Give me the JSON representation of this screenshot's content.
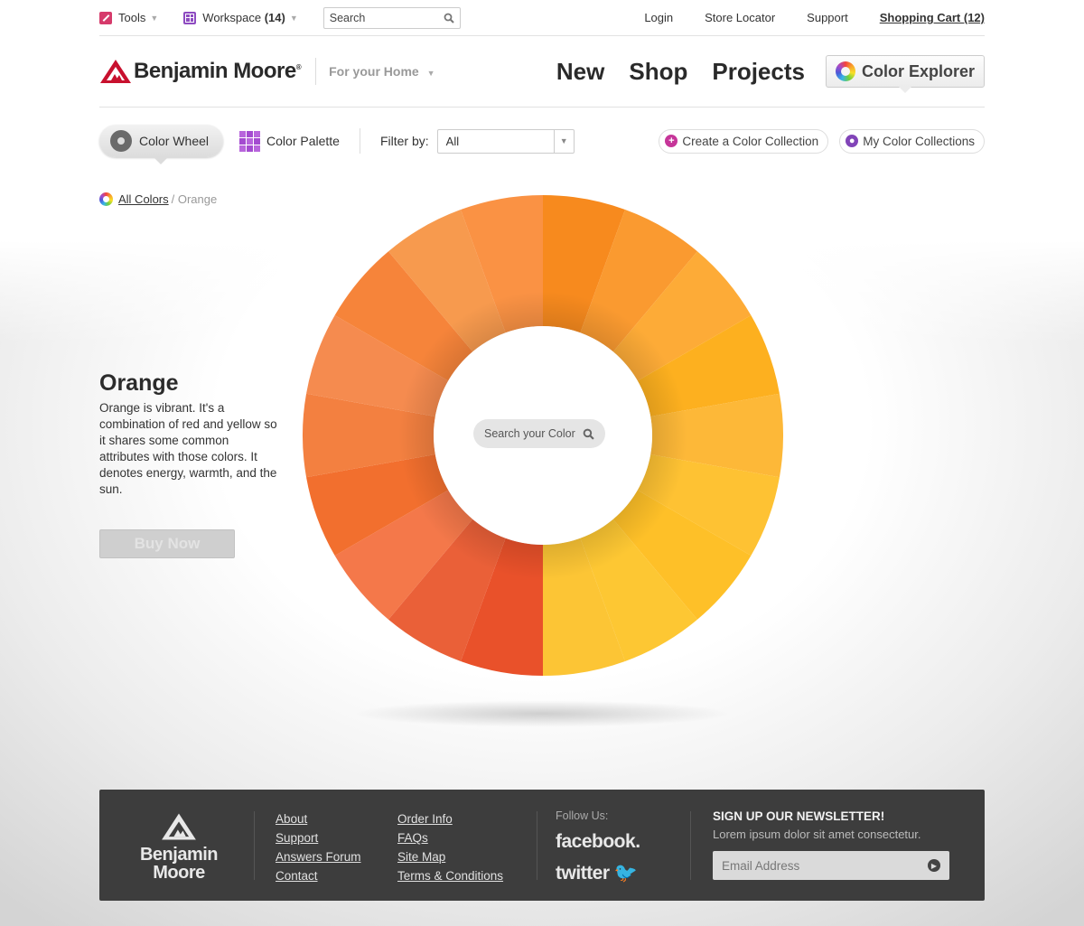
{
  "utility": {
    "tools": "Tools",
    "workspace": "Workspace",
    "workspace_count": "(14)",
    "search_placeholder": "Search",
    "login": "Login",
    "store_locator": "Store Locator",
    "support": "Support",
    "cart": "Shopping Cart (12)"
  },
  "header": {
    "brand": "Benjamin Moore",
    "for_home": "For your Home",
    "nav": [
      "New",
      "Shop",
      "Projects"
    ],
    "color_explorer": "Color Explorer"
  },
  "toolbar": {
    "color_wheel": "Color Wheel",
    "color_palette": "Color Palette",
    "filter_label": "Filter by:",
    "filter_value": "All",
    "create_collection": "Create a Color Collection",
    "my_collections": "My Color Collections"
  },
  "breadcrumb": {
    "all_colors": "All Colors",
    "current": "Orange"
  },
  "description": {
    "title": "Orange",
    "text": "Orange is vibrant. It's a combination of red and yellow so it shares some common attributes with those colors. It denotes energy, warmth, and the sun.",
    "buy_now": "Buy Now"
  },
  "wheel": {
    "search_placeholder": "Search your Color",
    "segment_colors": [
      "#f78a1e",
      "#fa9a30",
      "#fdab37",
      "#fdb01f",
      "#fdb838",
      "#fec233",
      "#fec028",
      "#fdc733",
      "#fcc535",
      "#e9512a",
      "#ea6038",
      "#f4784a",
      "#f26f2e",
      "#f38040",
      "#f58b4f",
      "#f6843a",
      "#f79a4e",
      "#fa9244"
    ]
  },
  "footer": {
    "brand_line1": "Benjamin",
    "brand_line2": "Moore",
    "col1": [
      "About",
      "Support",
      "Answers Forum",
      "Contact"
    ],
    "col2": [
      "Order Info",
      "FAQs",
      "Site Map",
      "Terms & Conditions"
    ],
    "follow": "Follow Us:",
    "facebook": "facebook.",
    "twitter": "twitter",
    "newsletter_title": "SIGN UP OUR NEWSLETTER!",
    "newsletter_sub": "Lorem ipsum dolor sit amet consectetur.",
    "email_placeholder": "Email Address"
  }
}
